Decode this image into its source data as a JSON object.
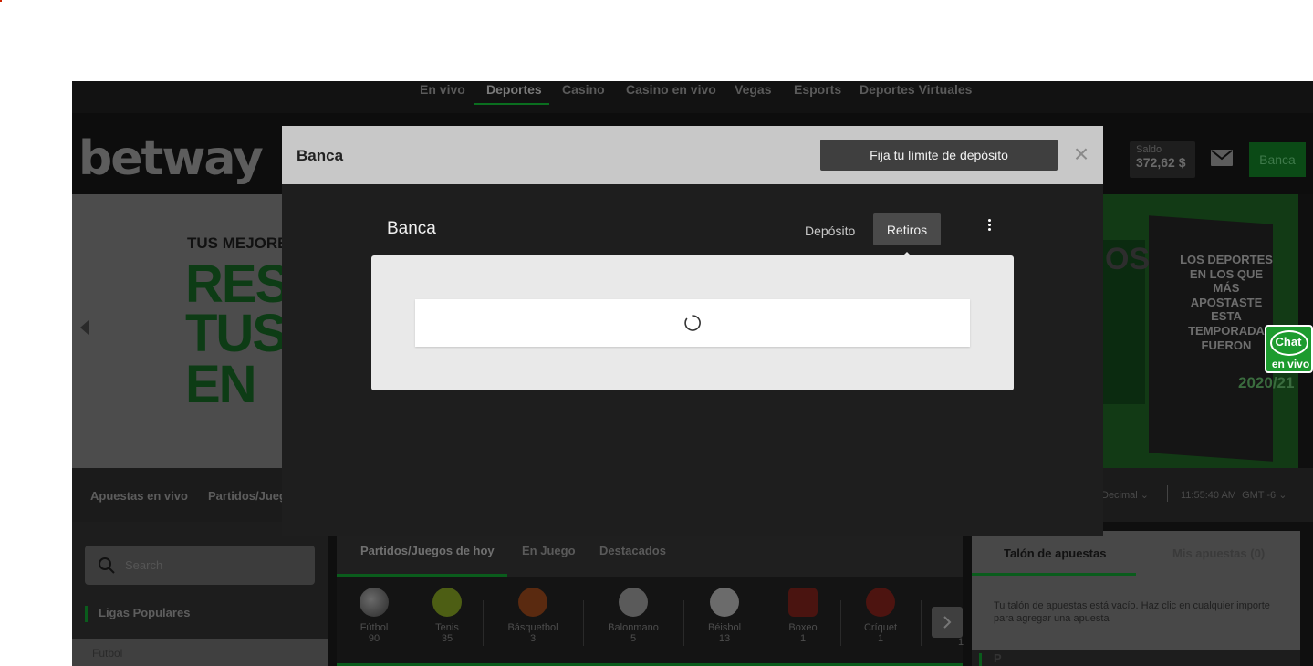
{
  "top_nav": {
    "items": [
      "En vivo",
      "Deportes",
      "Casino",
      "Casino en vivo",
      "Vegas",
      "Esports",
      "Deportes Virtuales"
    ],
    "active": "Deportes"
  },
  "header": {
    "logo": "betway",
    "balance_label": "Saldo",
    "balance_value": "372,62 $",
    "banca_label": "Banca"
  },
  "banner": {
    "tagline": "TUS MEJORE",
    "lines": [
      "RES",
      "TUS",
      "EN"
    ],
    "poster_text": "OS",
    "card_text": "LOS DEPORTES EN LOS QUE MÁS APOSTASTE ESTA TEMPORADA FUERON",
    "year": "2020/21"
  },
  "sport_bar": {
    "links": [
      "Apuestas en vivo",
      "Partidos/Jueg"
    ],
    "odds_format": "Decimal",
    "time": "11:55:40 AM",
    "timezone": "GMT -6"
  },
  "left_col": {
    "search_placeholder": "Search",
    "ligas_title": "Ligas Populares",
    "first_league": "Futbol"
  },
  "center_col": {
    "tabs": [
      "Partidos/Juegos de hoy",
      "En Juego",
      "Destacados"
    ],
    "sports": [
      {
        "name": "Fútbol",
        "count": "90"
      },
      {
        "name": "Tenis",
        "count": "35"
      },
      {
        "name": "Básquetbol",
        "count": "3"
      },
      {
        "name": "Balonmano",
        "count": "5"
      },
      {
        "name": "Béisbol",
        "count": "13"
      },
      {
        "name": "Boxeo",
        "count": "1"
      },
      {
        "name": "Críquet",
        "count": "1"
      }
    ],
    "partial_count": "1"
  },
  "right_col": {
    "tabs": [
      "Talón de apuestas",
      "Mis apuestas (0)"
    ],
    "empty_message": "Tu talón de apuestas está vacío. Haz clic en cualquier importe para agregar una apuesta",
    "next_section": "P"
  },
  "chat": {
    "line1": "Chat",
    "line2": "en vivo"
  },
  "modal": {
    "title": "Banca",
    "limit_button": "Fija tu límite de depósito",
    "close": "×",
    "inner_title": "Banca",
    "tab_deposit": "Depósito",
    "tab_withdraw": "Retiros",
    "active_tab": "Retiros",
    "state": "loading"
  }
}
